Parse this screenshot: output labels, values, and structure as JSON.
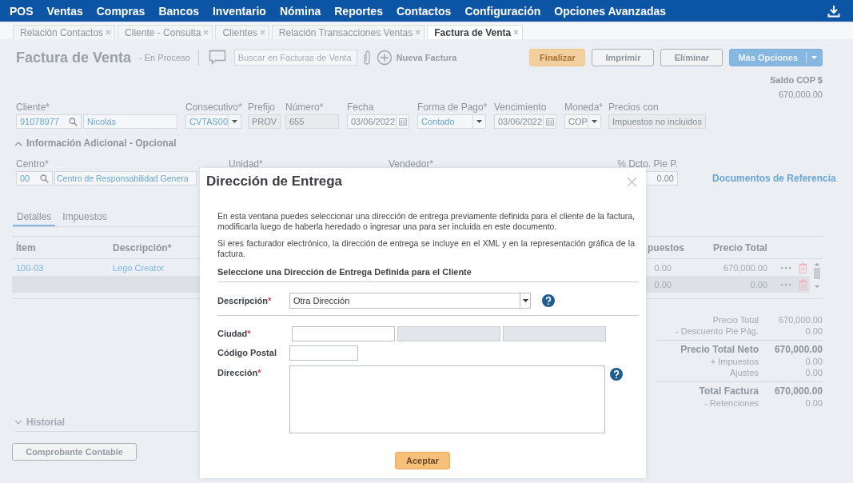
{
  "nav": {
    "items": [
      "POS",
      "Ventas",
      "Compras",
      "Bancos",
      "Inventario",
      "Nómina",
      "Reportes",
      "Contactos",
      "Configuración",
      "Opciones Avanzadas"
    ]
  },
  "tabs": [
    {
      "label": "Relación Contactos",
      "selected": false
    },
    {
      "label": "Cliente - Consulta",
      "selected": false
    },
    {
      "label": "Clientes",
      "selected": false
    },
    {
      "label": "Relación Transacciones Ventas",
      "selected": false
    },
    {
      "label": "Factura de Venta",
      "selected": true
    }
  ],
  "header": {
    "title": "Factura de Venta",
    "status": "- En Proceso",
    "search": {
      "placeholder": "Buscar en Facturas de Venta"
    },
    "new_label": "Nueva Factura",
    "buttons": [
      {
        "label": "Finalizar",
        "kind": "primary"
      },
      {
        "label": "Imprimir",
        "kind": "outline"
      },
      {
        "label": "Eliminar",
        "kind": "outline"
      },
      {
        "label": "Más Opciones",
        "kind": "split"
      }
    ],
    "balance_label": "Saldo COP $",
    "balance": "670,000.00"
  },
  "form": [
    {
      "label": "Cliente*",
      "kind": "search",
      "value": "91078977",
      "name": "Nicolás",
      "readonly": false,
      "highlighted": true
    },
    {
      "label": "Consecutivo*",
      "kind": "select",
      "value": "CVTAS00",
      "readonly": false,
      "highlighted": true
    },
    {
      "label": "Prefijo",
      "kind": "text",
      "value": "PROV",
      "readonly": true,
      "highlighted": false
    },
    {
      "label": "Número*",
      "kind": "text",
      "value": "655",
      "readonly": true,
      "highlighted": false
    },
    {
      "label": "Fecha",
      "kind": "date",
      "value": "03/06/2022",
      "readonly": false,
      "highlighted": false
    },
    {
      "label": "Forma de Pago*",
      "kind": "select",
      "value": "Contado",
      "readonly": false,
      "highlighted": true
    },
    {
      "label": "Vencimiento",
      "kind": "date",
      "value": "03/06/2022",
      "readonly": false,
      "highlighted": false
    },
    {
      "label": "Moneda*",
      "kind": "select",
      "value": "COP",
      "readonly": false,
      "highlighted": false
    },
    {
      "label": "Precios con",
      "kind": "text",
      "value": "Impuestos no incluidos",
      "readonly": true,
      "highlighted": false
    }
  ],
  "additional": {
    "label": "Información Adicional - Opcional",
    "expanded": true,
    "fields": [
      {
        "label": "Centro*",
        "kind": "search",
        "value": "00",
        "name": "Centro de Responsabilidad Genera",
        "readonly": false,
        "highlighted": true
      },
      {
        "label": "Unidad*",
        "kind": "label"
      },
      {
        "label": "Vendedor*",
        "kind": "label"
      },
      {
        "label": "% Dcto. Pie P.",
        "kind": "number",
        "value": "0.00",
        "readonly": false,
        "highlighted": false
      }
    ],
    "link": "Documentos de Referencia"
  },
  "detail_tabs": [
    {
      "label": "Detalles",
      "selected": true
    },
    {
      "label": "Impuestos",
      "selected": false
    }
  ],
  "table": {
    "columns": [
      "Ítem",
      "Descripción*",
      "puestos",
      "Precio Total"
    ],
    "rows": [
      {
        "item": "100-03",
        "description": "Lego Creator",
        "column_3": "0.00",
        "total": "670,000.00",
        "selected": false
      },
      {
        "column_3": "0.00",
        "total": "0.00",
        "selected": true
      }
    ]
  },
  "totals": [
    [
      {
        "label": "Precio Total",
        "value": "670,000.00",
        "bold": false
      },
      {
        "label": "- Descuento Pie Pág.",
        "value": "0.00",
        "bold": false
      }
    ],
    [
      {
        "label": "Precio Total Neto",
        "value": "670,000.00",
        "bold": true
      },
      {
        "label": "+ Impuestos",
        "value": "0.00",
        "bold": false
      },
      {
        "label": "Ajustes",
        "value": "0.00",
        "bold": false
      }
    ],
    [
      {
        "label": "Total Factura",
        "value": "670,000.00",
        "bold": true
      },
      {
        "label": "- Retenciones",
        "value": "0.00",
        "bold": false
      }
    ]
  ],
  "history": {
    "label": "Historial",
    "expanded": false
  },
  "voucher_button": "Comprobante Contable",
  "dialog": {
    "title": "Dirección de Entrega",
    "paragraphs": [
      "En esta ventana puedes seleccionar una dirección de entrega previamente definida para el cliente de la factura, modificarla luego de haberla heredado o ingresar una para ser incluida en este documento.",
      "Si eres facturador electrónico, la dirección de entrega se incluye en el XML y en la representación gráfica de la factura."
    ],
    "section": "Seleccione una Dirección de Entrega Definida para el Cliente",
    "description": {
      "label": "Descripción",
      "mark": "*",
      "value": "Otra Dirección"
    },
    "fields": [
      {
        "label": "Ciudad",
        "mark": "*",
        "kind": "triple",
        "inputs": [
          {
            "readonly": false
          },
          {
            "readonly": true
          },
          {
            "readonly": true
          }
        ]
      },
      {
        "label": "Código Postal",
        "kind": "short"
      },
      {
        "label": "Dirección",
        "mark": "*",
        "kind": "textarea"
      }
    ],
    "accept_button": "Aceptar"
  }
}
